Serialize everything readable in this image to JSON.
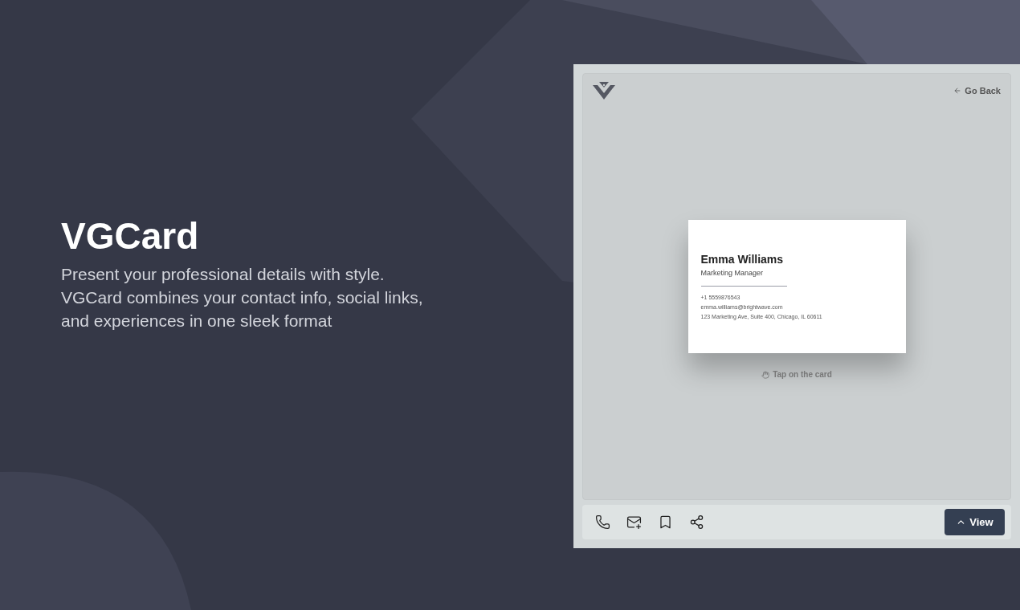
{
  "hero": {
    "title": "VGCard",
    "description": "Present your professional details with style. VGCard combines your contact info, social links, and experiences in one sleek format"
  },
  "preview": {
    "go_back": "Go Back",
    "card": {
      "name": "Emma Williams",
      "role": "Marketing Manager",
      "phone": "+1 5559876543",
      "email": "emma.williams@brightwave.com",
      "address": "123 Marketing Ave, Suite 400, Chicago, IL 60611"
    },
    "hint": "Tap on the card",
    "actions": [
      {
        "kind": "phone"
      },
      {
        "kind": "email"
      },
      {
        "kind": "bookmark"
      },
      {
        "kind": "share"
      }
    ],
    "view_button": "View"
  }
}
